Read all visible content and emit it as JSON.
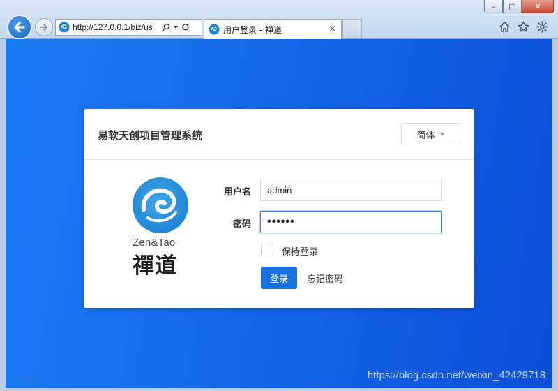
{
  "window": {
    "minimize_label": "–",
    "maximize_label": "□",
    "close_label": "✕"
  },
  "browser": {
    "address": "http://127.0.0.1/biz/us",
    "tab_title": "用户登录 - 禅道",
    "tab_close": "×",
    "icons": [
      "back-arrow-icon",
      "forward-arrow-icon",
      "zentao-favicon-icon",
      "search-icon",
      "dropdown-icon",
      "refresh-icon",
      "home-icon",
      "favorites-star-icon",
      "settings-gear-icon"
    ]
  },
  "login": {
    "title": "易软天创项目管理系统",
    "language": "简体",
    "username_label": "用户名",
    "username_value": "admin",
    "password_label": "密码",
    "password_value": "••••••",
    "keep_login_label": "保持登录",
    "keep_login_checked": false,
    "submit_label": "登录",
    "forgot_label": "忘记密码"
  },
  "logo": {
    "brand_en": "Zen&Tao",
    "brand_cn": "禪道"
  },
  "colors": {
    "page_background": "#1668e8",
    "primary_button": "#1871e0",
    "focus_border": "#3b82e8"
  },
  "watermark": "https://blog.csdn.net/weixin_42429718"
}
